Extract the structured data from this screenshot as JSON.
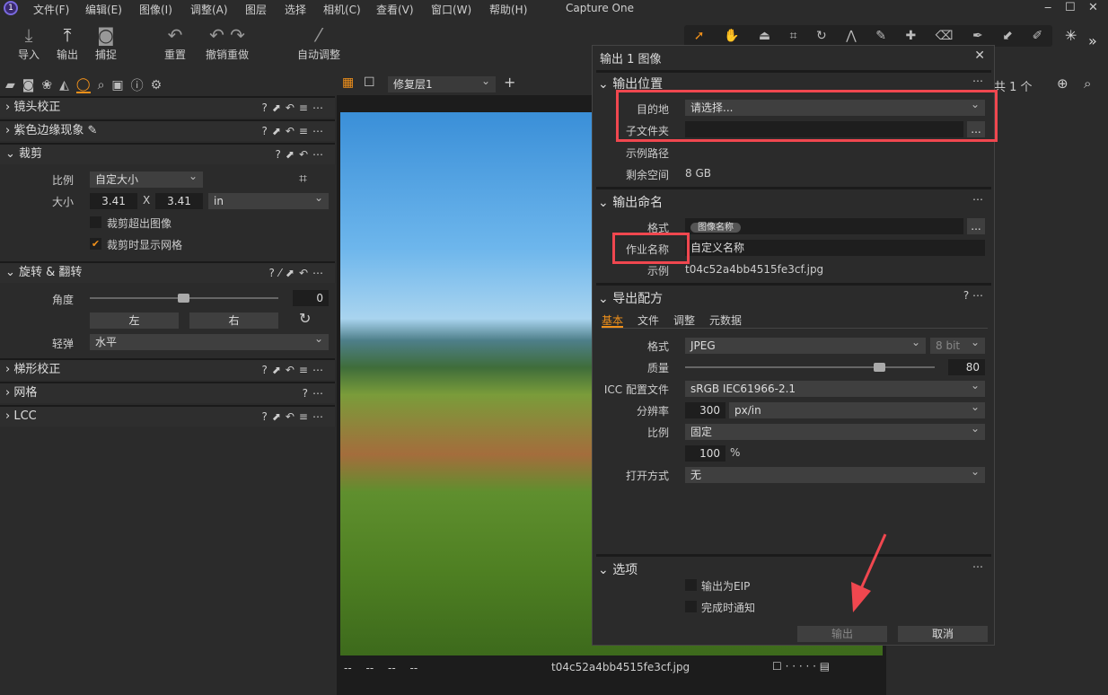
{
  "app": {
    "title": "Capture One",
    "logo": "1"
  },
  "menu": [
    "文件(F)",
    "编辑(E)",
    "图像(I)",
    "调整(A)",
    "图层",
    "选择",
    "相机(C)",
    "查看(V)",
    "窗口(W)",
    "帮助(H)"
  ],
  "toolbar": {
    "import": "导入",
    "export": "输出",
    "capture": "捕捉",
    "reset": "重置",
    "undo_redo": "撤销重做",
    "auto_adjust": "自动调整"
  },
  "left": {
    "sections": {
      "lens": "镜头校正",
      "purple": "紫色边缘现象",
      "crop": "裁剪",
      "rotate": "旋转 & 翻转",
      "keystone": "梯形校正",
      "grid": "网格",
      "lcc": "LCC"
    },
    "crop": {
      "ratio_label": "比例",
      "ratio": "自定大小",
      "size_label": "大小",
      "w": "3.41",
      "x": "X",
      "h": "3.41",
      "unit": "in",
      "outside": "裁剪超出图像",
      "show_grid": "裁剪时显示网格",
      "show_grid_checked": true
    },
    "rotate": {
      "angle_label": "角度",
      "angle": "0",
      "angle_fraction": 0.5,
      "left": "左",
      "right": "右",
      "flip_label": "轻弹",
      "flip": "水平"
    }
  },
  "viewer": {
    "layer": "修复层1",
    "filename": "t04c52a4bb4515fe3cf.jpg",
    "meta": [
      "--",
      "--",
      "--",
      "--"
    ]
  },
  "right": {
    "count": "共 1 个"
  },
  "dialog": {
    "title": "输出 1 图像",
    "location": {
      "title": "输出位置",
      "dest_label": "目的地",
      "dest": "请选择...",
      "sub_label": "子文件夹",
      "sub": "",
      "browse": "...",
      "path_label": "示例路径",
      "space_label": "剩余空间",
      "space": "8 GB"
    },
    "naming": {
      "title": "输出命名",
      "format_label": "格式",
      "token": "图像名称",
      "job_label": "作业名称",
      "job": "自定义名称",
      "sample_label": "示例",
      "sample": "t04c52a4bb4515fe3cf.jpg"
    },
    "recipe": {
      "title": "导出配方",
      "tabs": [
        "基本",
        "文件",
        "调整",
        "元数据"
      ],
      "format_label": "格式",
      "format": "JPEG",
      "bit": "8 bit",
      "quality_label": "质量",
      "quality": "80",
      "quality_fraction": 0.8,
      "icc_label": "ICC 配置文件",
      "icc": "sRGB IEC61966-2.1",
      "res_label": "分辨率",
      "res": "300",
      "res_unit": "px/in",
      "scale_label": "比例",
      "scale": "固定",
      "scale_pct": "100",
      "pct": "%",
      "open_label": "打开方式",
      "open": "无"
    },
    "options": {
      "title": "选项",
      "eip": "输出为EIP",
      "notify": "完成时通知"
    },
    "export_btn": "输出",
    "cancel_btn": "取消"
  },
  "colors": {
    "accent": "#f0901a",
    "annotation": "#f0474f"
  }
}
